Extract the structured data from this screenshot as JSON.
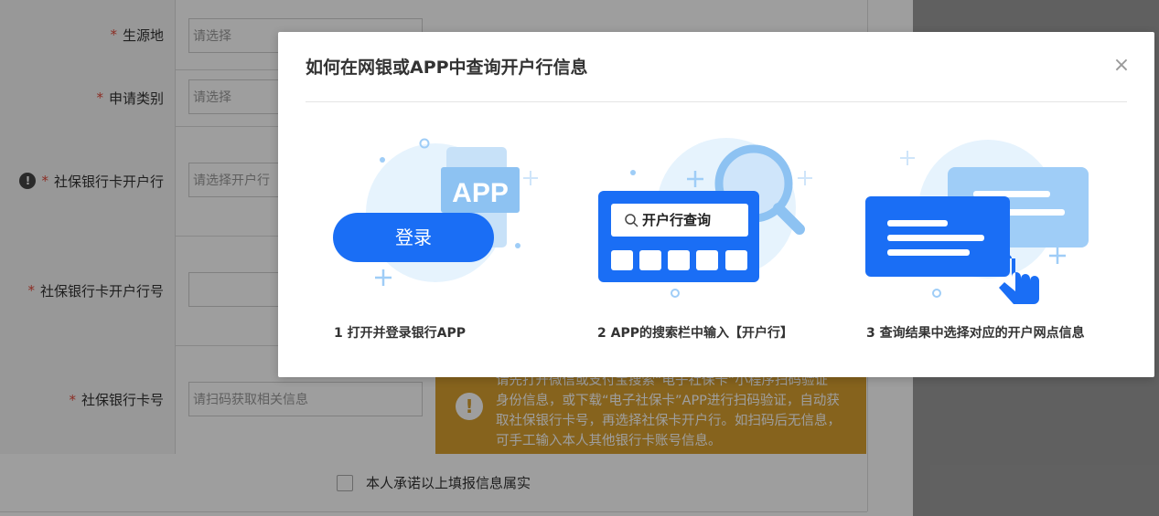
{
  "form": {
    "rows": [
      {
        "label": "生源地",
        "placeholder": "请选择"
      },
      {
        "label": "申请类别",
        "placeholder": "请选择"
      },
      {
        "label": "社保银行卡开户行",
        "placeholder": "请选择开户行"
      },
      {
        "label": "社保银行卡开户行号",
        "placeholder": ""
      },
      {
        "label": "社保银行卡号",
        "placeholder": "请扫码获取相关信息"
      }
    ],
    "required_mark": "*",
    "warn_mark": "!",
    "notice": {
      "partial_top": "请先打开微信或支付宝搜索“电子社保卡”小程序扫码验证",
      "lines": "身份信息，或下载“电子社保卡”APP进行扫码验证，自动获取社保银行卡号，再选择社保卡开户行。如扫码后无信息，可手工输入本人其他银行卡账号信息。",
      "icon": "!"
    },
    "agree_label": "本人承诺以上填报信息属实"
  },
  "modal": {
    "title": "如何在网银或APP中查询开户行信息",
    "close": "×",
    "steps": [
      {
        "caption": "1 打开并登录银行APP",
        "badge": "APP",
        "button": "登录"
      },
      {
        "caption": "2 APP的搜索栏中输入【开户行】",
        "search_text": "开户行查询"
      },
      {
        "caption": "3 查询结果中选择对应的开户网点信息"
      }
    ]
  },
  "colors": {
    "blue": "#1a6ef5",
    "light_blue": "#9fcdf7",
    "pale_blue": "#e6f3fd",
    "notice": "#d9a02f"
  }
}
